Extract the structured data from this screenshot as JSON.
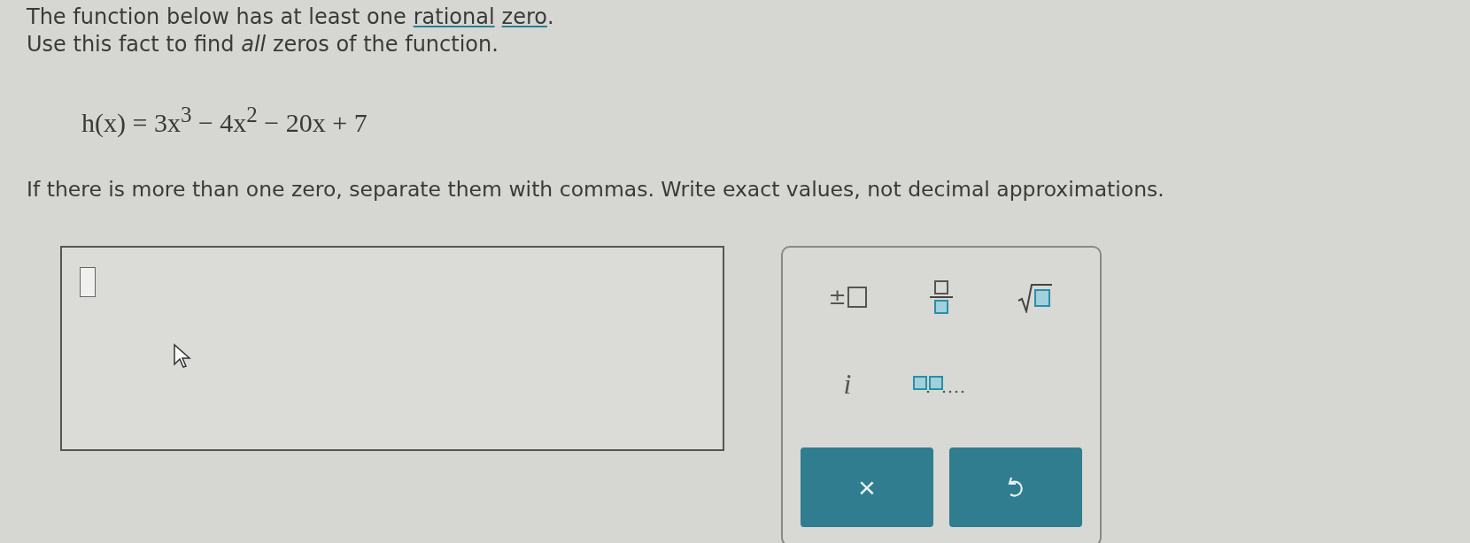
{
  "prompt": {
    "line1": [
      {
        "kind": "text",
        "text": "The function below has at least one"
      },
      {
        "kind": "link",
        "text": "rational"
      },
      {
        "kind": "link",
        "text": "zero"
      },
      {
        "kind": "text",
        "text": "."
      }
    ],
    "line2": "Use this fact to find *all* zeros of the function.",
    "equation": "h(x) = 3x$^{3}$ − 4x$^{2}$ − 20x + 7",
    "instruction": "If there is more than one zero, separate them with commas. Write exact values, not decimal approximations."
  },
  "answer": {
    "placeholder_cursor": true
  },
  "keypad": {
    "keys": [
      {
        "kind": "plus-minus",
        "label": "±"
      },
      {
        "kind": "fraction"
      },
      {
        "kind": "sqrt"
      },
      {
        "kind": "imaginary",
        "label": "i"
      },
      {
        "kind": "list"
      }
    ],
    "actions": [
      {
        "kind": "clear",
        "label": "×"
      },
      {
        "kind": "undo"
      }
    ]
  }
}
